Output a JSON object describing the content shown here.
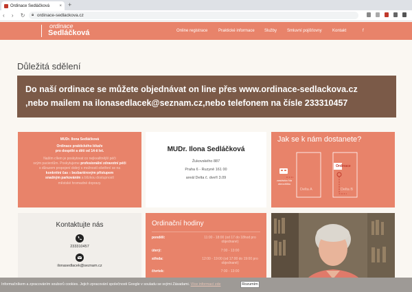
{
  "browser": {
    "tab_title": "Ordinace Sedláčková",
    "tab_close": "×",
    "new_tab": "+",
    "url": "ordinace-sedlackova.cz"
  },
  "site": {
    "logo_line1": "ordinace",
    "logo_line2": "Sedláčková",
    "nav": [
      {
        "label": "Online registrace"
      },
      {
        "label": "Praktické informace"
      },
      {
        "label": "Služby"
      },
      {
        "label": "Smluvní pojišťovny"
      },
      {
        "label": "Kontakt"
      },
      {
        "label": "f"
      }
    ]
  },
  "main": {
    "heading": "Důležitá sdělení",
    "banner_line1": "Do naší  ordinace se můžete objednávat on line přes www.ordinace-sedlackova.cz",
    "banner_line2": ",nebo mailem na ilonasedlacek@seznam.cz,nebo telefonem na čísle 233310457"
  },
  "card_about": {
    "name": "MUDr. Ilona Sedláčková",
    "sub1": "Ordinace praktického lékaře",
    "sub2": "pro dospělé a děti od 14-ti let.",
    "p1": "Naším cílem je poskytovat co nejkvalitnější péči",
    "p2": "svým pacientům. Poskytujeme",
    "p2b": "profesionální zdravotní péči",
    "p3": "s důrazem propojení dobrý s možností ošetření se na",
    "p4a": "konkrétní čas",
    "p4b": "s",
    "p4c": "bezbariérovým přístupem",
    "p5": "snadným parkováním",
    "p5b": "a blízkou dostupností",
    "p6": "městské hromadné dopravy."
  },
  "card_address": {
    "name": "MUDr. Ilona Sedláčková",
    "street": "Žukovského 887",
    "city": "Praha 6 - Ruzyně 161 00",
    "building": "areál Delta č. dveří 3.09"
  },
  "card_map": {
    "title": "Jak se k nám dostanete?",
    "bus_label": "zastávka Na okrouhlíku",
    "badge": "Ordinace",
    "delta_a": "Delta A",
    "delta_b": "Delta B"
  },
  "card_contact": {
    "title": "Kontaktujte nás",
    "phone": "233310457",
    "email": "ilonasedlacek@seznam.cz"
  },
  "card_hours": {
    "title": "Ordinační hodiny",
    "rows": [
      {
        "day": "pondělí:",
        "hours": "11:00 - 18:00 (od 17 do 18hod pro objednané)"
      },
      {
        "day": "úterý:",
        "hours": "7:00 - 13:00"
      },
      {
        "day": "středa:",
        "hours": "12:00 - 19:00 (od 17:00 do 19:00 pro objednané)"
      },
      {
        "day": "čtvrtek:",
        "hours": "7:00 - 13:00"
      }
    ]
  },
  "cookie_bar": {
    "text": "Informačníkem a zpracováním souborů cookies. Jejich zpracování společnosti Google v souladu se svými Zásadami.",
    "link": "Více informací zde",
    "button": "Rozumím"
  },
  "colors": {
    "accent": "#e8836a",
    "banner": "#7b5a48",
    "page_bg": "#faf7f2"
  }
}
